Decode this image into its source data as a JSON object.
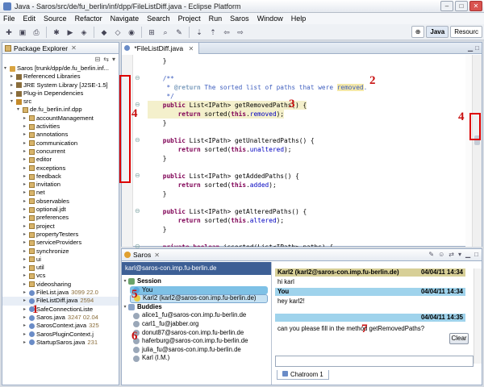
{
  "window": {
    "title": "Java - Saros/src/de/fu_berlin/inf/dpp/FileListDiff.java - Eclipse Platform"
  },
  "menu": [
    "File",
    "Edit",
    "Source",
    "Refactor",
    "Navigate",
    "Search",
    "Project",
    "Run",
    "Saros",
    "Window",
    "Help"
  ],
  "perspectives": {
    "java": "Java",
    "resource": "Resourc"
  },
  "package_explorer": {
    "tab": "Package Explorer",
    "tree": [
      {
        "label": "Saros [trunk/dpp/de.fu_berlin.inf...",
        "icon": "project-icon",
        "indent": 0,
        "twisty": "open"
      },
      {
        "label": "Referenced Libraries",
        "icon": "library-icon",
        "indent": 1,
        "twisty": "closed"
      },
      {
        "label": "JRE System Library [J2SE-1.5]",
        "icon": "library-icon",
        "indent": 1,
        "twisty": "closed"
      },
      {
        "label": "Plug-in Dependencies",
        "icon": "library-icon",
        "indent": 1,
        "twisty": "closed"
      },
      {
        "label": "src",
        "icon": "source-folder-icon",
        "indent": 1,
        "twisty": "open"
      },
      {
        "label": "de.fu_berlin.inf.dpp",
        "icon": "package-icon",
        "indent": 2,
        "twisty": "open"
      },
      {
        "label": "accountManagement",
        "icon": "package-icon",
        "indent": 3,
        "twisty": "closed"
      },
      {
        "label": "activities",
        "icon": "package-icon",
        "indent": 3,
        "twisty": "closed"
      },
      {
        "label": "annotations",
        "icon": "package-icon",
        "indent": 3,
        "twisty": "closed"
      },
      {
        "label": "communication",
        "icon": "package-icon",
        "indent": 3,
        "twisty": "closed"
      },
      {
        "label": "concurrent",
        "icon": "package-icon",
        "indent": 3,
        "twisty": "closed"
      },
      {
        "label": "editor",
        "icon": "package-icon",
        "indent": 3,
        "twisty": "closed"
      },
      {
        "label": "exceptions",
        "icon": "package-icon",
        "indent": 3,
        "twisty": "closed"
      },
      {
        "label": "feedback",
        "icon": "package-icon",
        "indent": 3,
        "twisty": "closed"
      },
      {
        "label": "invitation",
        "icon": "package-icon",
        "indent": 3,
        "twisty": "closed"
      },
      {
        "label": "net",
        "icon": "package-icon",
        "indent": 3,
        "twisty": "closed"
      },
      {
        "label": "observables",
        "icon": "package-icon",
        "indent": 3,
        "twisty": "closed"
      },
      {
        "label": "optional.jdt",
        "icon": "package-icon",
        "indent": 3,
        "twisty": "closed"
      },
      {
        "label": "preferences",
        "icon": "package-icon",
        "indent": 3,
        "twisty": "closed"
      },
      {
        "label": "project",
        "icon": "package-icon",
        "indent": 3,
        "twisty": "closed"
      },
      {
        "label": "propertyTesters",
        "icon": "package-icon",
        "indent": 3,
        "twisty": "closed"
      },
      {
        "label": "serviceProviders",
        "icon": "package-icon",
        "indent": 3,
        "twisty": "closed"
      },
      {
        "label": "synchronize",
        "icon": "package-icon",
        "indent": 3,
        "twisty": "closed"
      },
      {
        "label": "ui",
        "icon": "package-icon",
        "indent": 3,
        "twisty": "closed"
      },
      {
        "label": "util",
        "icon": "package-icon",
        "indent": 3,
        "twisty": "closed"
      },
      {
        "label": "vcs",
        "icon": "package-icon",
        "indent": 3,
        "twisty": "closed"
      },
      {
        "label": "videosharing",
        "icon": "package-icon",
        "indent": 3,
        "twisty": "closed"
      },
      {
        "label": "FileList.java",
        "suffix": "3099  22.0",
        "icon": "java-file-icon",
        "indent": 3,
        "twisty": "closed"
      },
      {
        "label": "FileListDiff.java",
        "suffix": "2594",
        "icon": "java-file-icon",
        "indent": 3,
        "twisty": "closed"
      },
      {
        "label": "SafeConnectionListe",
        "icon": "java-file-icon",
        "indent": 3,
        "twisty": "closed"
      },
      {
        "label": "Saros.java",
        "suffix": "3247  02.04",
        "icon": "java-file-icon",
        "indent": 3,
        "twisty": "closed"
      },
      {
        "label": "SarosContext.java",
        "suffix": "325",
        "icon": "java-file-icon",
        "indent": 3,
        "twisty": "closed"
      },
      {
        "label": "SarosPluginContext.j",
        "icon": "java-file-icon",
        "indent": 3,
        "twisty": "closed"
      },
      {
        "label": "StartupSaros.java",
        "suffix": "231",
        "icon": "java-file-icon",
        "indent": 3,
        "twisty": "closed"
      }
    ]
  },
  "editor": {
    "tab": "*FileListDiff.java",
    "code_lines": [
      [
        {
          "t": "    }"
        }
      ],
      [
        {
          "t": ""
        }
      ],
      [
        {
          "t": "    /**",
          "c": "cm"
        }
      ],
      [
        {
          "t": "     * ",
          "c": "cm"
        },
        {
          "t": "@return",
          "c": "tag"
        },
        {
          "t": " The sorted list of paths that were ",
          "c": "cm"
        },
        {
          "t": "removed",
          "c": "cm hl2"
        },
        {
          "t": ".",
          "c": "cm"
        }
      ],
      [
        {
          "t": "     */",
          "c": "cm"
        }
      ],
      [
        {
          "t": "    "
        },
        {
          "t": "public",
          "c": "kw"
        },
        {
          "t": " List<IPath> getRemovedPaths() {"
        }
      ],
      [
        {
          "t": "        "
        },
        {
          "t": "return",
          "c": "kw"
        },
        {
          "t": " sorted("
        },
        {
          "t": "this",
          "c": "kw"
        },
        {
          "t": "."
        },
        {
          "t": "removed",
          "c": "fld"
        },
        {
          "t": ");"
        }
      ],
      [
        {
          "t": "    }"
        }
      ],
      [
        {
          "t": ""
        }
      ],
      [
        {
          "t": "    "
        },
        {
          "t": "public",
          "c": "kw"
        },
        {
          "t": " List<IPath> getUnalteredPaths() {"
        }
      ],
      [
        {
          "t": "        "
        },
        {
          "t": "return",
          "c": "kw"
        },
        {
          "t": " sorted("
        },
        {
          "t": "this",
          "c": "kw"
        },
        {
          "t": "."
        },
        {
          "t": "unaltered",
          "c": "fld"
        },
        {
          "t": ");"
        }
      ],
      [
        {
          "t": "    }"
        }
      ],
      [
        {
          "t": ""
        }
      ],
      [
        {
          "t": "    "
        },
        {
          "t": "public",
          "c": "kw"
        },
        {
          "t": " List<IPath> getAddedPaths() {"
        }
      ],
      [
        {
          "t": "        "
        },
        {
          "t": "return",
          "c": "kw"
        },
        {
          "t": " sorted("
        },
        {
          "t": "this",
          "c": "kw"
        },
        {
          "t": "."
        },
        {
          "t": "added",
          "c": "fld"
        },
        {
          "t": ");"
        }
      ],
      [
        {
          "t": "    }"
        }
      ],
      [
        {
          "t": ""
        }
      ],
      [
        {
          "t": "    "
        },
        {
          "t": "public",
          "c": "kw"
        },
        {
          "t": " List<IPath> getAlteredPaths() {"
        }
      ],
      [
        {
          "t": "        "
        },
        {
          "t": "return",
          "c": "kw"
        },
        {
          "t": " sorted("
        },
        {
          "t": "this",
          "c": "kw"
        },
        {
          "t": "."
        },
        {
          "t": "altered",
          "c": "fld"
        },
        {
          "t": ");"
        }
      ],
      [
        {
          "t": "    }"
        }
      ],
      [
        {
          "t": ""
        }
      ],
      [
        {
          "t": "    "
        },
        {
          "t": "private",
          "c": "kw"
        },
        {
          "t": " "
        },
        {
          "t": "boolean",
          "c": "kw"
        },
        {
          "t": " issorted(List<IPath> paths) {"
        }
      ]
    ]
  },
  "saros": {
    "tab": "Saros",
    "roster_header": "karl@saros-con.imp.fu-berlin.de",
    "session_label": "Session",
    "session_you": "You",
    "session_karl": "Karl2 (karl2@saros-con.imp.fu-berlin.de)",
    "buddies_label": "Buddies",
    "buddies": [
      "alice1_fu@saros-con.imp.fu-berlin.de",
      "carl1_fu@jabber.org",
      "donut87@saros-con.imp.fu-berlin.de",
      "haferburg@saros-con.imp.fu-berlin.de",
      "julia_fu@saros-con.imp.fu-berlin.de",
      "Karl (I.M.)"
    ],
    "chat": {
      "m1_sender": "Karl2 (karl2@saros-con.imp.fu-berlin.de)",
      "m1_time": "04/04/11 14:34",
      "m1_text": "hi karl",
      "m2_sender": "You",
      "m2_time": "04/04/11 14:34",
      "m2_text": "hey karl2!",
      "m3_time": "04/04/11 14:35",
      "m3_text": "can you please fill in the method getRemovedPaths?",
      "clear": "Clear",
      "tab": "Chatroom 1"
    },
    "colors": {
      "karl2_header": "#d7cf97",
      "you_header": "#9fd3ec",
      "karl2_dot": "#e6cf49",
      "you_dot": "#5aa6de"
    }
  },
  "annotations": [
    "1",
    "2",
    "3",
    "4",
    "4",
    "5",
    "6",
    "7"
  ]
}
